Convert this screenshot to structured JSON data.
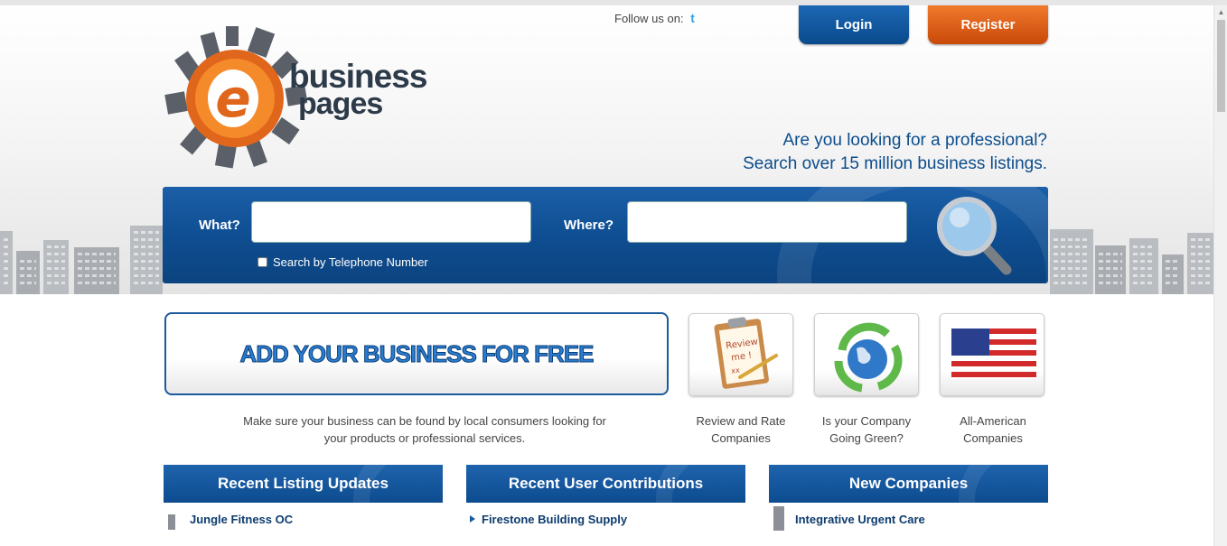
{
  "header": {
    "logo": {
      "line1": "business",
      "line2": "pages"
    },
    "follow_label": "Follow us on:",
    "twitter_glyph": "t",
    "login_label": "Login",
    "register_label": "Register",
    "tagline_line1": "Are you looking for a professional?",
    "tagline_line2": "Search over 15 million business listings."
  },
  "search": {
    "what_label": "What?",
    "where_label": "Where?",
    "what_value": "",
    "where_value": "",
    "telephone_checkbox_label": "Search by Telephone Number",
    "telephone_checked": false
  },
  "promo": {
    "add_business_label": "ADD YOUR BUSINESS FOR FREE",
    "add_business_desc_line1": "Make sure your business can be found by local consumers looking for",
    "add_business_desc_line2": "your products or professional services.",
    "features": [
      {
        "icon": "review-clipboard-icon",
        "image_text_line1": "Review",
        "image_text_line2": "me !",
        "image_text_line3": "xx",
        "label_line1": "Review and Rate",
        "label_line2": "Companies"
      },
      {
        "icon": "recycle-globe-icon",
        "label_line1": "Is your Company",
        "label_line2": "Going Green?"
      },
      {
        "icon": "american-flag-icon",
        "label_line1": "All-American",
        "label_line2": "Companies"
      }
    ]
  },
  "sections": [
    {
      "title": "Recent Listing Updates",
      "first_item": "Jungle Fitness OC",
      "icon": "building-icon"
    },
    {
      "title": "Recent User Contributions",
      "first_item": "Firestone Building Supply",
      "icon": "triangle-bullet-icon"
    },
    {
      "title": "New Companies",
      "first_item": "Integrative Urgent Care",
      "icon": "building-icon"
    }
  ],
  "colors": {
    "brand_blue": "#0f4e92",
    "brand_orange": "#e0661c",
    "link_navy": "#0d3c6e"
  }
}
